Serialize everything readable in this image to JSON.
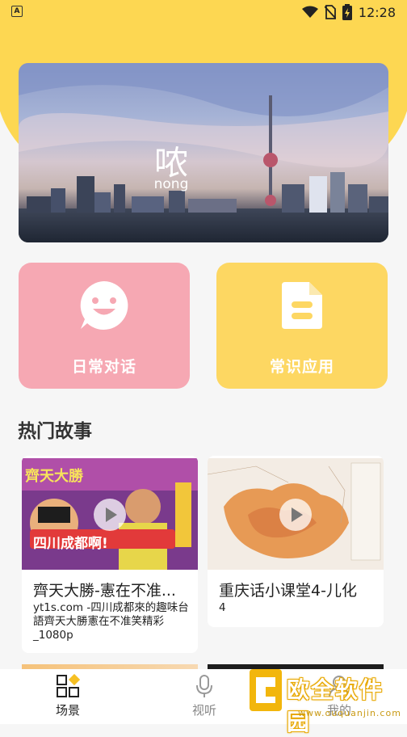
{
  "status_bar": {
    "time": "12:28"
  },
  "banner": {
    "character": "哝",
    "pinyin": "nong"
  },
  "cards": [
    {
      "label": "日常对话",
      "icon": "smile-chat-icon",
      "color": "#f6a8b3"
    },
    {
      "label": "常识应用",
      "icon": "document-icon",
      "color": "#fdd762"
    }
  ],
  "section": {
    "title": "热门故事"
  },
  "stories": [
    {
      "title": "齊天大勝-憲在不准...",
      "desc": "yt1s.com -四川成都來的趣味台語齊天大勝憲在不准笑精彩_1080p",
      "thumb_text": "四川成都啊!"
    },
    {
      "title": "重庆话小课堂4-儿化",
      "desc": "4"
    }
  ],
  "nav": [
    {
      "label": "场景",
      "icon": "grid-icon"
    },
    {
      "label": "视听",
      "icon": "microphone-icon"
    },
    {
      "label": "我的",
      "icon": "user-icon"
    }
  ],
  "watermark": {
    "text": "欧全软件园",
    "url": "www.ouquanjin.com"
  },
  "colors": {
    "accent": "#fdd752",
    "pink": "#f6a8b3"
  }
}
